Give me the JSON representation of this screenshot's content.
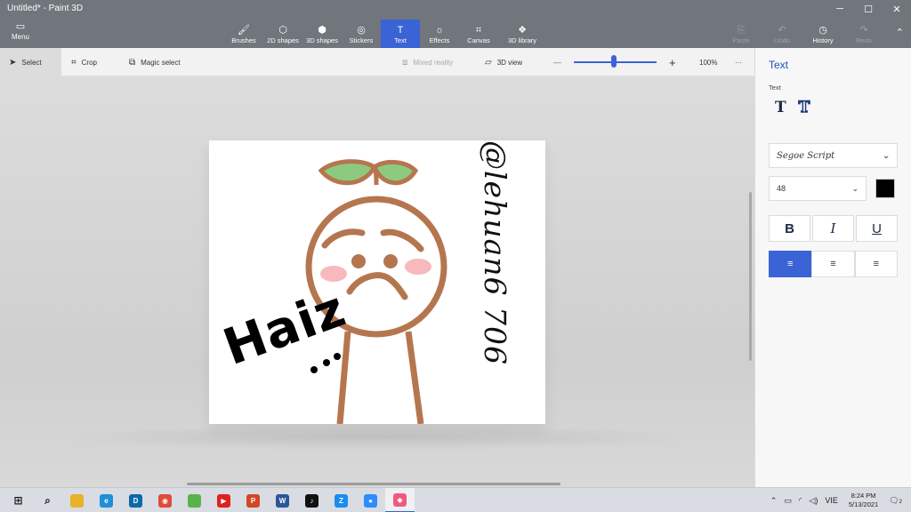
{
  "window": {
    "title": "Untitled* - Paint 3D",
    "minimize": "─",
    "maximize": "☐",
    "close": "✕"
  },
  "menu": {
    "label": "Menu",
    "icon": "folder-icon"
  },
  "ribbon": {
    "tools": [
      {
        "label": "Brushes",
        "icon": "brush-icon",
        "glyph": "🖌"
      },
      {
        "label": "2D shapes",
        "icon": "shapes-2d-icon",
        "glyph": "⬡"
      },
      {
        "label": "3D shapes",
        "icon": "cube-icon",
        "glyph": "⬢"
      },
      {
        "label": "Stickers",
        "icon": "sticker-icon",
        "glyph": "◎"
      },
      {
        "label": "Text",
        "icon": "text-icon",
        "glyph": "T"
      },
      {
        "label": "Effects",
        "icon": "sun-icon",
        "glyph": "☼"
      },
      {
        "label": "Canvas",
        "icon": "canvas-icon",
        "glyph": "⌗"
      },
      {
        "label": "3D library",
        "icon": "library-icon",
        "glyph": "❖"
      }
    ],
    "right_tools": [
      {
        "label": "Paste",
        "glyph": "⎘"
      },
      {
        "label": "Undo",
        "glyph": "↶"
      },
      {
        "label": "History",
        "glyph": "◷"
      },
      {
        "label": "Redo",
        "glyph": "↷"
      }
    ],
    "collapse": "⌃"
  },
  "options": {
    "select": "Select",
    "crop": "Crop",
    "magic_select": "Magic select",
    "mixed_reality": "Mixed reality",
    "view_3d": "3D view",
    "zoom_out": "—",
    "zoom_in": "+",
    "zoom": "100%",
    "more": "···",
    "zoom_level": 0.48
  },
  "canvas": {
    "haiz_text": "Haiz",
    "vertical_text": "@lehuan6 706"
  },
  "panel": {
    "title": "Text",
    "subtitle": "Text",
    "font": "Segoe Script",
    "size": "48",
    "color": "#000000",
    "bold": "B",
    "italic": "I",
    "underline": "U",
    "align_left": "≡",
    "align_center": "≡",
    "align_right": "≡"
  },
  "taskbar": {
    "apps": [
      {
        "name": "start-icon",
        "color": "#1b1b1b",
        "glyph": "⊞"
      },
      {
        "name": "search-icon",
        "color": "#1b1b1b",
        "glyph": "⌕"
      },
      {
        "name": "file-explorer-icon",
        "color": "#e8b22a",
        "glyph": ""
      },
      {
        "name": "edge-icon",
        "color": "#1f8fd8",
        "glyph": "e"
      },
      {
        "name": "dell-icon",
        "color": "#0b6aa8",
        "glyph": "D"
      },
      {
        "name": "chrome-icon",
        "color": "#e04a3a",
        "glyph": "◉"
      },
      {
        "name": "app-green-icon",
        "color": "#5ab34a",
        "glyph": ""
      },
      {
        "name": "youtube-icon",
        "color": "#e02020",
        "glyph": "▶"
      },
      {
        "name": "powerpoint-icon",
        "color": "#d24726",
        "glyph": "P"
      },
      {
        "name": "word-icon",
        "color": "#2b5797",
        "glyph": "W"
      },
      {
        "name": "tiktok-icon",
        "color": "#111111",
        "glyph": "♪"
      },
      {
        "name": "zalo-icon",
        "color": "#1b8cf0",
        "glyph": "Z"
      },
      {
        "name": "zoom-icon",
        "color": "#2d8cff",
        "glyph": "●"
      },
      {
        "name": "paint3d-icon",
        "color": "#f05a7e",
        "glyph": "◆"
      }
    ],
    "tray": {
      "chevron": "⌃",
      "lang": "VIE",
      "time": "8:24 PM",
      "date": "5/13/2021",
      "notifications": "2"
    }
  }
}
